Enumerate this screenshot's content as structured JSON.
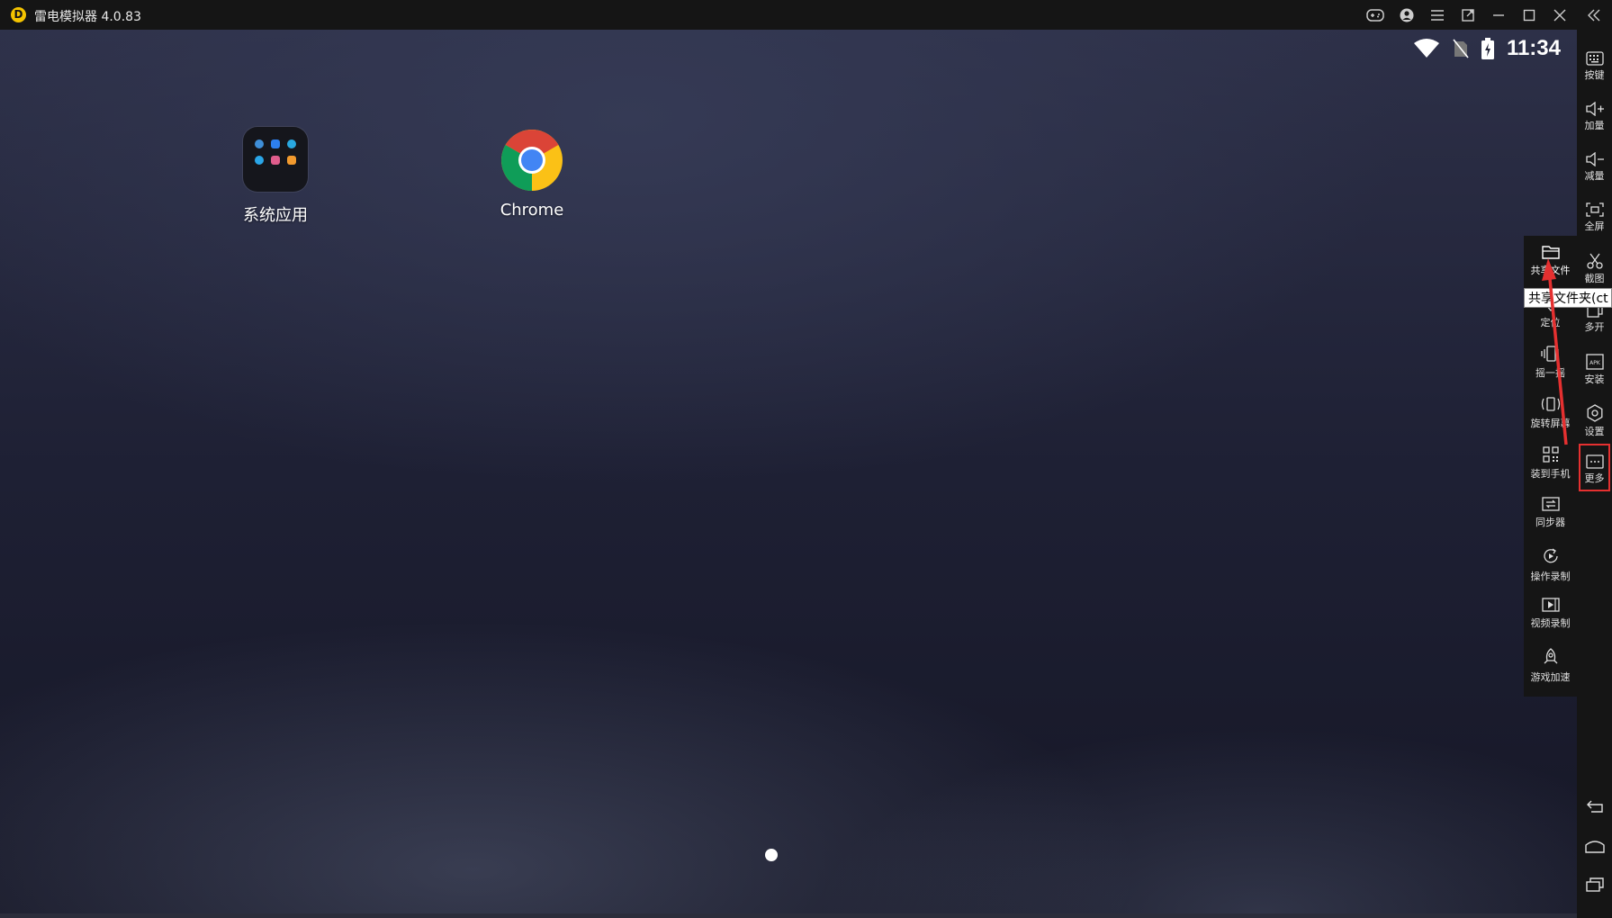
{
  "window": {
    "title": "雷电模拟器 4.0.83",
    "logo_letter": "D",
    "controls": [
      "gamepad-icon",
      "account-icon",
      "menu-icon",
      "pin-icon",
      "minimize-icon",
      "maximize-icon",
      "close-icon",
      "collapse-icon"
    ]
  },
  "statusbar": {
    "time": "11:34",
    "icons": [
      "wifi-icon",
      "no-sim-icon",
      "battery-charging-icon"
    ]
  },
  "desktop": {
    "apps": [
      {
        "label": "系统应用"
      },
      {
        "label": "Chrome"
      }
    ]
  },
  "sidebar": {
    "items": [
      {
        "label": "按键",
        "icon": "keyboard-icon"
      },
      {
        "label": "加量",
        "icon": "volume-up-icon"
      },
      {
        "label": "减量",
        "icon": "volume-down-icon"
      },
      {
        "label": "全屏",
        "icon": "fullscreen-icon"
      },
      {
        "label": "截图",
        "icon": "scissors-icon"
      },
      {
        "label": "多开",
        "icon": "multi-instance-icon"
      },
      {
        "label": "安装",
        "icon": "apk-icon"
      },
      {
        "label": "设置",
        "icon": "gear-icon"
      },
      {
        "label": "更多",
        "icon": "more-icon"
      }
    ],
    "nav": [
      "back-icon",
      "home-icon",
      "recents-icon"
    ]
  },
  "more_panel": {
    "items": [
      {
        "label": "共享文件",
        "icon": "folder-icon"
      },
      {
        "label": "定位",
        "icon": "location-icon"
      },
      {
        "label": "摇一摇",
        "icon": "shake-icon"
      },
      {
        "label": "旋转屏幕",
        "icon": "rotate-icon"
      },
      {
        "label": "装到手机",
        "icon": "qr-code-icon"
      },
      {
        "label": "同步器",
        "icon": "sync-icon"
      },
      {
        "label": "操作录制",
        "icon": "macro-record-icon"
      },
      {
        "label": "视频录制",
        "icon": "video-record-icon"
      },
      {
        "label": "游戏加速",
        "icon": "rocket-icon"
      }
    ]
  },
  "tooltip": {
    "text": "共享文件夹(ct"
  },
  "colors": {
    "annotation_red": "#e53030",
    "sidebar_bg": "#151515",
    "logo_yellow": "#f5c400"
  }
}
